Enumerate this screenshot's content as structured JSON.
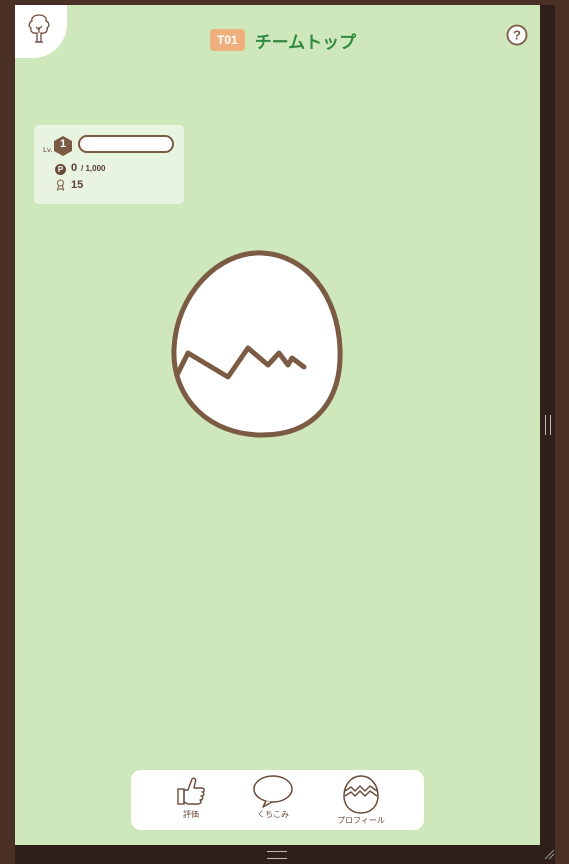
{
  "header": {
    "team_code": "T01",
    "title": "チームトップ",
    "help_label": "?"
  },
  "status": {
    "level_label": "Lv.",
    "level": "1",
    "exp_progress": 0,
    "points_value": "0",
    "points_max": "/ 1,000",
    "badge_count": "15"
  },
  "nav": {
    "items": [
      {
        "label": "評価",
        "icon": "thumbs-up-icon"
      },
      {
        "label": "くちこみ",
        "icon": "speech-bubble-icon"
      },
      {
        "label": "プロフィール",
        "icon": "cracked-egg-icon"
      }
    ]
  },
  "colors": {
    "background": "#cfe8bb",
    "accent_green": "#2f8a3f",
    "badge_orange": "#f0b07d",
    "brown": "#7c5b45"
  }
}
